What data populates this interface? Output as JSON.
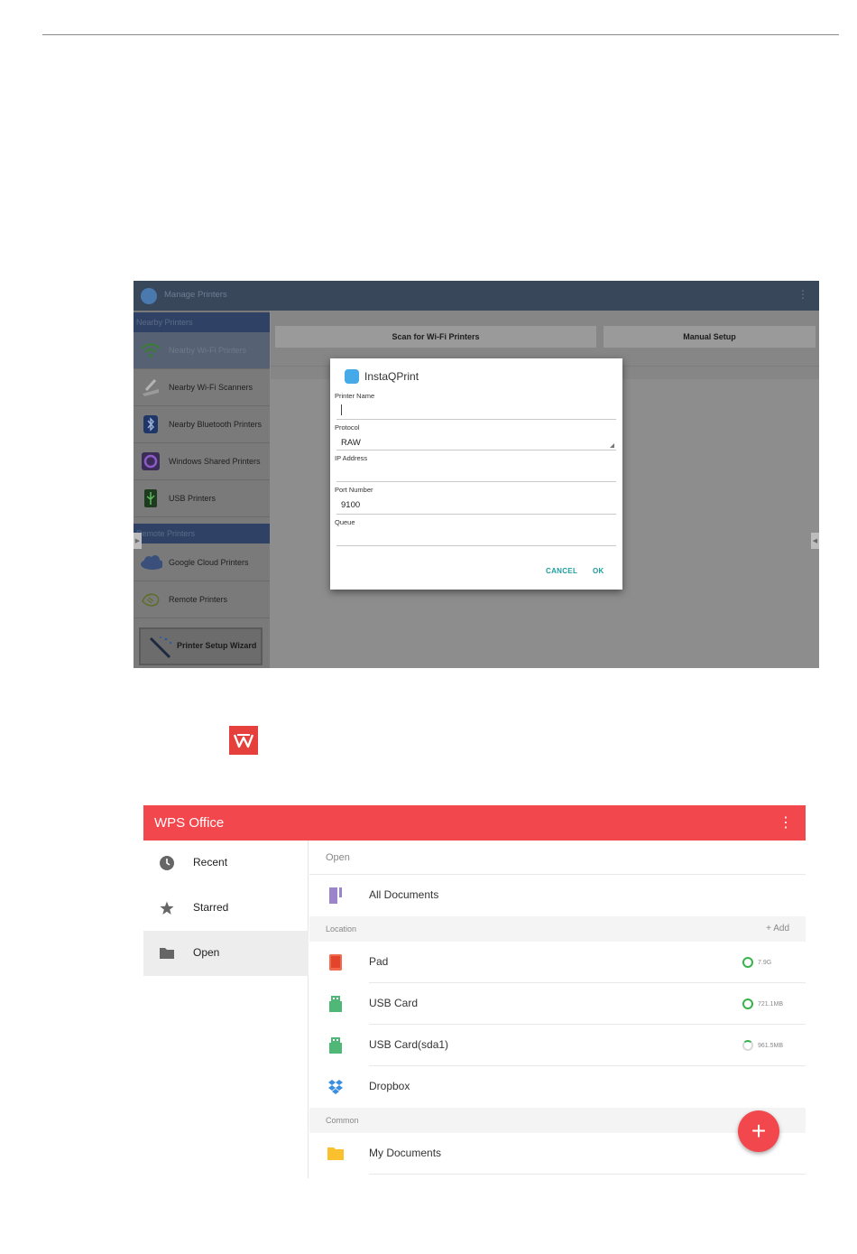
{
  "insta": {
    "app_bar_title": "Manage Printers",
    "menu_icon": "⋮",
    "sections": {
      "nearby": "Nearby Printers",
      "remote": "Remote Printers"
    },
    "sidebar": [
      {
        "label": "Nearby Wi-Fi Printers",
        "icon": "wifi-icon",
        "selected": true
      },
      {
        "label": "Nearby Wi-Fi Scanners",
        "icon": "scanner-icon"
      },
      {
        "label": "Nearby Bluetooth Printers",
        "icon": "bluetooth-icon"
      },
      {
        "label": "Windows Shared Printers",
        "icon": "windows-share-icon"
      },
      {
        "label": "USB Printers",
        "icon": "usb-icon"
      },
      {
        "label": "Google Cloud Printers",
        "icon": "cloud-icon"
      },
      {
        "label": "Remote Printers",
        "icon": "remote-printer-icon"
      }
    ],
    "wizard": "Printer Setup Wizard",
    "toolbar": {
      "scan": "Scan for Wi-Fi Printers",
      "manual": "Manual Setup"
    },
    "dialog": {
      "title": "InstaQPrint",
      "printer_name_label": "Printer Name",
      "printer_name_value": "",
      "protocol_label": "Protocol",
      "protocol_value": "RAW",
      "ip_label": "IP Address",
      "ip_value": "",
      "port_label": "Port Number",
      "port_value": "9100",
      "queue_label": "Queue",
      "queue_value": "",
      "cancel": "CANCEL",
      "ok": "OK"
    }
  },
  "wps": {
    "title": "WPS Office",
    "menu_icon": "⋮",
    "nav": [
      {
        "label": "Recent",
        "icon": "clock-icon"
      },
      {
        "label": "Starred",
        "icon": "star-icon"
      },
      {
        "label": "Open",
        "icon": "folder-icon",
        "selected": true
      }
    ],
    "open_label": "Open",
    "all_documents": "All Documents",
    "location_header": "Location",
    "add_label": "+ Add",
    "locations": [
      {
        "label": "Pad",
        "icon": "pad-icon",
        "storage": "7.9G",
        "usage": "full"
      },
      {
        "label": "USB Card",
        "icon": "usb-card-icon",
        "storage": "721.1MB",
        "usage": "full"
      },
      {
        "label": "USB Card(sda1)",
        "icon": "usb-card-icon",
        "storage": "961.5MB",
        "usage": "partial"
      },
      {
        "label": "Dropbox",
        "icon": "dropbox-icon"
      }
    ],
    "common_header": "Common",
    "my_documents": "My Documents",
    "fab": "+",
    "colors": {
      "brand": "#f2474c",
      "storage_ok": "#38b24a"
    }
  }
}
